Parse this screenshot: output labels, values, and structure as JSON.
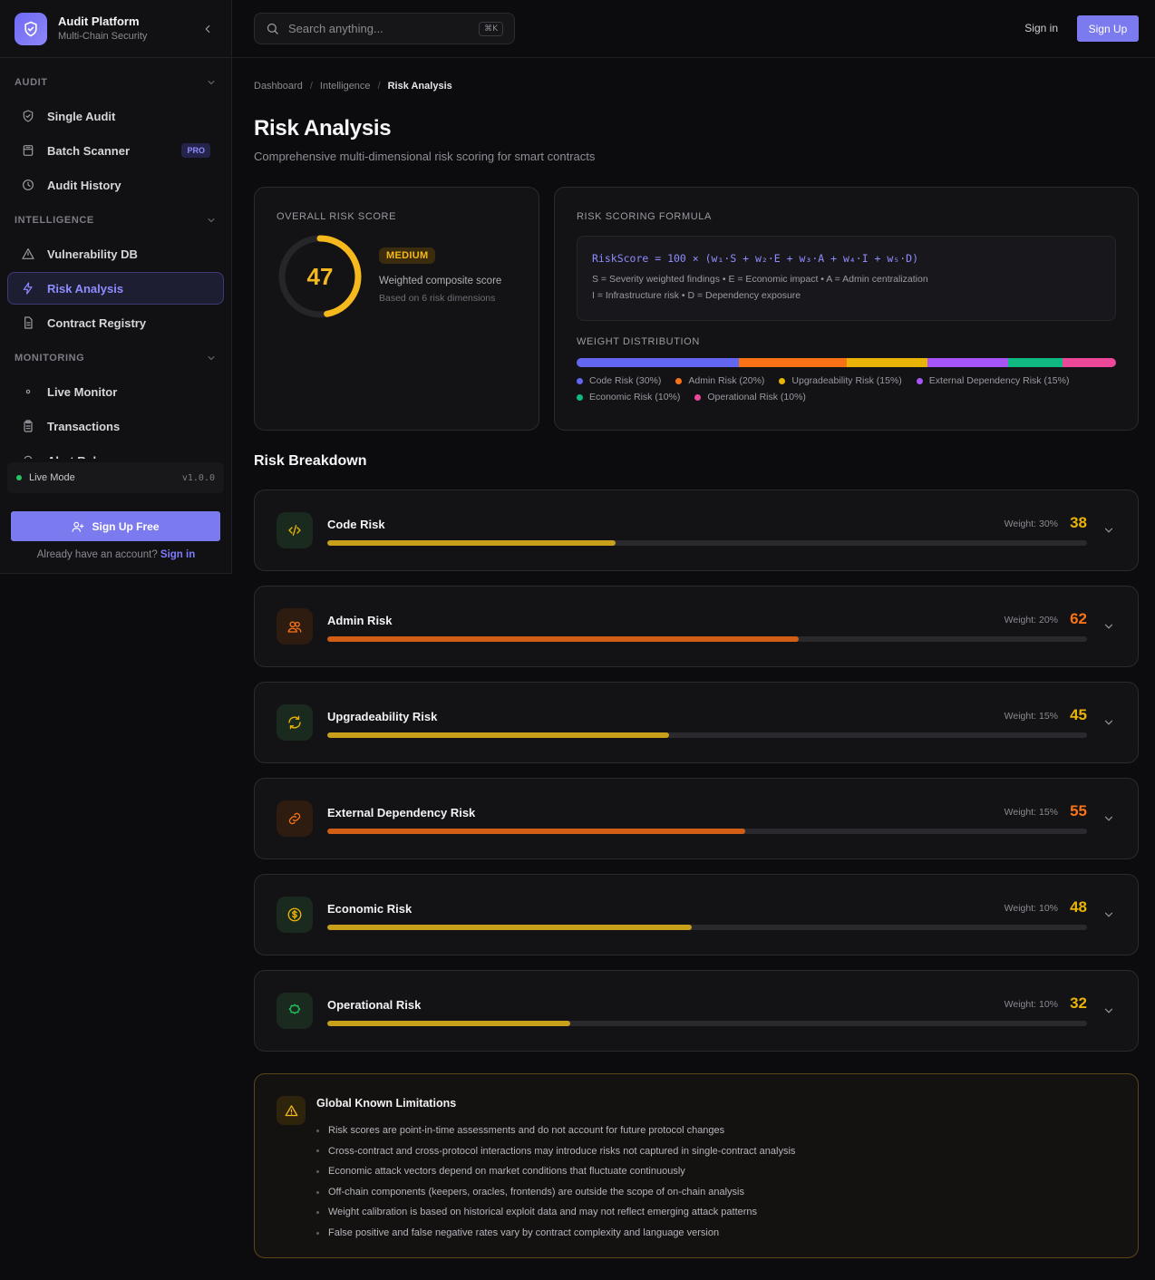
{
  "brand": {
    "title": "Audit Platform",
    "subtitle": "Multi-Chain Security"
  },
  "sidebar": {
    "sections": [
      {
        "label": "AUDIT",
        "items": [
          {
            "label": "Single Audit",
            "icon": "shield-check-icon"
          },
          {
            "label": "Batch Scanner",
            "icon": "layers-icon",
            "badge": "PRO"
          },
          {
            "label": "Audit History",
            "icon": "clock-icon"
          }
        ]
      },
      {
        "label": "INTELLIGENCE",
        "items": [
          {
            "label": "Vulnerability DB",
            "icon": "warning-triangle-icon"
          },
          {
            "label": "Risk Analysis",
            "icon": "lightning-icon",
            "active": true
          },
          {
            "label": "Contract Registry",
            "icon": "document-icon"
          }
        ]
      },
      {
        "label": "MONITORING",
        "items": [
          {
            "label": "Live Monitor",
            "icon": "dot-icon"
          },
          {
            "label": "Transactions",
            "icon": "clipboard-icon"
          },
          {
            "label": "Alert Rules",
            "icon": "bell-icon"
          }
        ]
      }
    ],
    "live_mode": "Live Mode",
    "version": "v1.0.0",
    "signup_free": "Sign Up Free",
    "account_prompt": "Already have an account?",
    "account_signin": "Sign in"
  },
  "topbar": {
    "search_placeholder": "Search anything...",
    "shortcut": "⌘K",
    "signin": "Sign in",
    "signup": "Sign Up"
  },
  "breadcrumb": [
    "Dashboard",
    "Intelligence",
    "Risk Analysis"
  ],
  "page": {
    "title": "Risk Analysis",
    "subtitle": "Comprehensive multi-dimensional risk scoring for smart contracts"
  },
  "overall": {
    "label": "OVERALL RISK SCORE",
    "score": 47,
    "max": 100,
    "level": "MEDIUM",
    "level_color": "#f5b81d",
    "description": "Weighted composite score",
    "note": "Based on 6 risk dimensions"
  },
  "formula": {
    "label": "RISK SCORING FORMULA",
    "expression": "RiskScore = 100 × (w₁·S + w₂·E + w₃·A + w₄·I + w₅·D)",
    "line1": "S = Severity weighted findings • E = Economic impact • A = Admin centralization",
    "line2": "I = Infrastructure risk • D = Dependency exposure",
    "weight_label": "WEIGHT DISTRIBUTION",
    "weights": [
      {
        "label": "Code Risk (30%)",
        "value": 30,
        "color": "#6366f1"
      },
      {
        "label": "Admin Risk (20%)",
        "value": 20,
        "color": "#f97316"
      },
      {
        "label": "Upgradeability Risk (15%)",
        "value": 15,
        "color": "#eab308"
      },
      {
        "label": "External Dependency Risk (15%)",
        "value": 15,
        "color": "#a855f7"
      },
      {
        "label": "Economic Risk (10%)",
        "value": 10,
        "color": "#10b981"
      },
      {
        "label": "Operational Risk (10%)",
        "value": 10,
        "color": "#ec4899"
      }
    ]
  },
  "breakdown": {
    "title": "Risk Breakdown",
    "items": [
      {
        "name": "Code Risk",
        "weight": "Weight: 30%",
        "score": 38,
        "score_color": "#eab308",
        "bar_color": "#c9a019",
        "icon": "code-icon",
        "icon_color": "#eab308",
        "icon_bg": "#1a2a1e"
      },
      {
        "name": "Admin Risk",
        "weight": "Weight: 20%",
        "score": 62,
        "score_color": "#f97316",
        "bar_color": "#d25e16",
        "icon": "users-icon",
        "icon_color": "#f97316",
        "icon_bg": "#2e1c10"
      },
      {
        "name": "Upgradeability Risk",
        "weight": "Weight: 15%",
        "score": 45,
        "score_color": "#eab308",
        "bar_color": "#c9a019",
        "icon": "refresh-icon",
        "icon_color": "#eab308",
        "icon_bg": "#1a2a1e"
      },
      {
        "name": "External Dependency Risk",
        "weight": "Weight: 15%",
        "score": 55,
        "score_color": "#f97316",
        "bar_color": "#d25e16",
        "icon": "link-icon",
        "icon_color": "#f97316",
        "icon_bg": "#2e1c10"
      },
      {
        "name": "Economic Risk",
        "weight": "Weight: 10%",
        "score": 48,
        "score_color": "#eab308",
        "bar_color": "#c9a019",
        "icon": "dollar-icon",
        "icon_color": "#eab308",
        "icon_bg": "#1a2a1e"
      },
      {
        "name": "Operational Risk",
        "weight": "Weight: 10%",
        "score": 32,
        "score_color": "#eab308",
        "bar_color": "#c9a019",
        "icon": "settings-icon",
        "icon_color": "#22c55e",
        "icon_bg": "#1a2a1e"
      }
    ]
  },
  "limitations": {
    "title": "Global Known Limitations",
    "items": [
      "Risk scores are point-in-time assessments and do not account for future protocol changes",
      "Cross-contract and cross-protocol interactions may introduce risks not captured in single-contract analysis",
      "Economic attack vectors depend on market conditions that fluctuate continuously",
      "Off-chain components (keepers, oracles, frontends) are outside the scope of on-chain analysis",
      "Weight calibration is based on historical exploit data and may not reflect emerging attack patterns",
      "False positive and false negative rates vary by contract complexity and language version"
    ]
  }
}
